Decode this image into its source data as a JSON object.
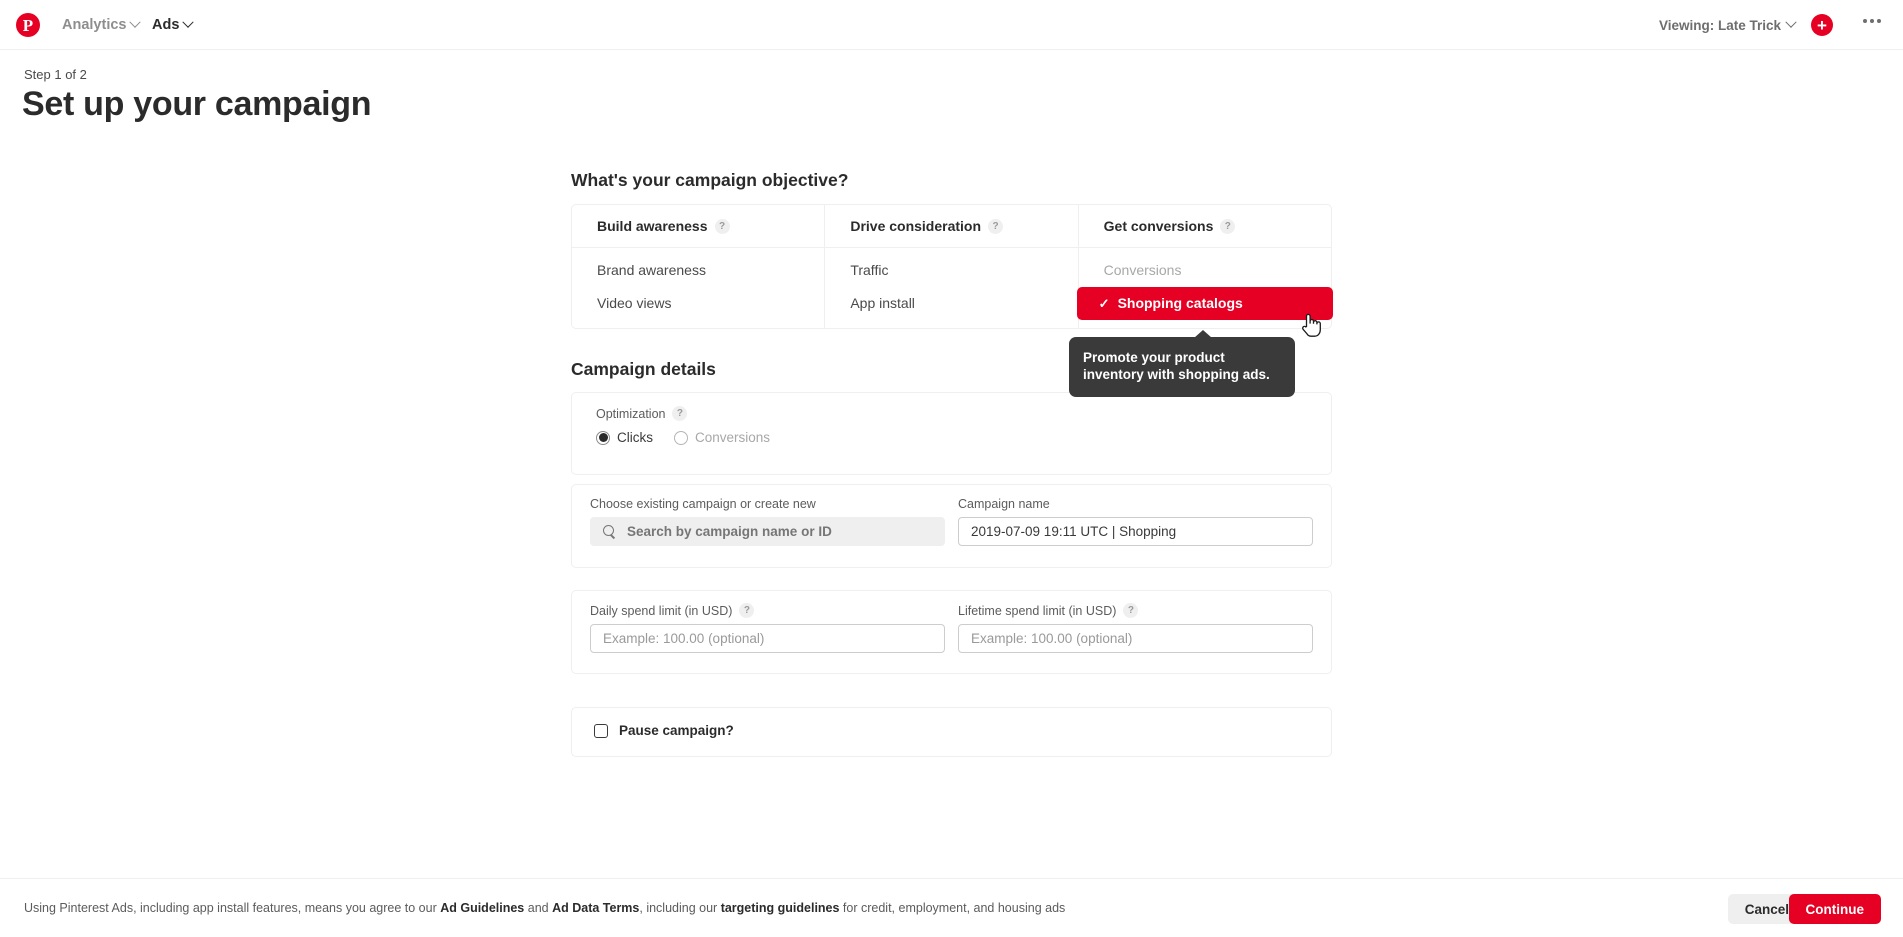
{
  "brand": {
    "logo_glyph": "P",
    "accent": "#e60023",
    "tooltip_bg": "#3a3a3a"
  },
  "topnav": {
    "analytics_label": "Analytics",
    "ads_label": "Ads",
    "viewing_label": "Viewing: Late Trick",
    "plus_label": "+"
  },
  "header": {
    "step": "Step 1 of 2",
    "title": "Set up your campaign"
  },
  "objective": {
    "heading": "What's your campaign objective?",
    "help_glyph": "?",
    "columns": [
      {
        "header": "Build awareness",
        "items": [
          {
            "label": "Brand awareness",
            "state": "normal"
          },
          {
            "label": "Video views",
            "state": "normal"
          }
        ]
      },
      {
        "header": "Drive consideration",
        "items": [
          {
            "label": "Traffic",
            "state": "normal"
          },
          {
            "label": "App install",
            "state": "normal"
          }
        ]
      },
      {
        "header": "Get conversions",
        "items": [
          {
            "label": "Conversions",
            "state": "disabled"
          },
          {
            "label": "Shopping catalogs",
            "state": "selected"
          }
        ]
      }
    ],
    "selected_check_glyph": "✓",
    "tooltip": "Promote your product inventory with shopping ads."
  },
  "details": {
    "heading": "Campaign details",
    "optimization": {
      "label": "Optimization",
      "options": [
        {
          "label": "Clicks",
          "selected": true,
          "disabled": false
        },
        {
          "label": "Conversions",
          "selected": false,
          "disabled": true
        }
      ]
    },
    "campaign_picker": {
      "label": "Choose existing campaign or create new",
      "search_placeholder": "Search by campaign name or ID",
      "search_value": ""
    },
    "campaign_name": {
      "label": "Campaign name",
      "value": "2019-07-09 19:11 UTC | Shopping",
      "placeholder": "Campaign name"
    },
    "daily_spend": {
      "label": "Daily spend limit (in USD)",
      "value": "",
      "placeholder": "Example: 100.00 (optional)"
    },
    "lifetime_spend": {
      "label": "Lifetime spend limit (in USD)",
      "value": "",
      "placeholder": "Example: 100.00 (optional)"
    },
    "pause": {
      "label": "Pause campaign?",
      "checked": false
    }
  },
  "footer": {
    "legal_1": "Using Pinterest Ads, including app install features, means you agree to our ",
    "link_1": "Ad Guidelines",
    "legal_2": " and ",
    "link_2": "Ad Data Terms",
    "legal_3": ", including our ",
    "link_3": "targeting guidelines",
    "legal_4": " for credit, employment, and housing ads",
    "cancel_label": "Cancel",
    "continue_label": "Continue"
  }
}
